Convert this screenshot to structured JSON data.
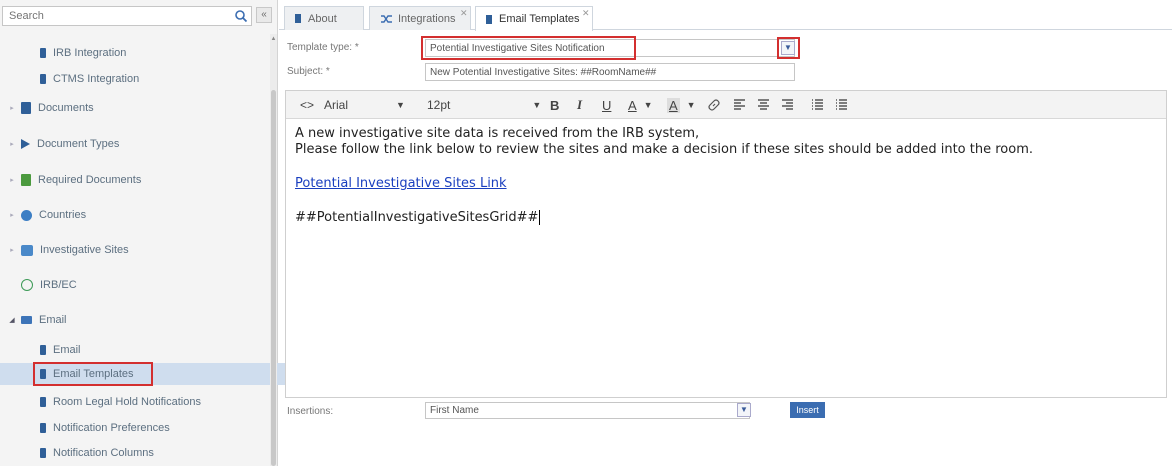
{
  "sidebar": {
    "search_placeholder": "Search",
    "collapse_glyph": "«",
    "items": [
      {
        "label": "IRB Integration",
        "icon": "document-icon"
      },
      {
        "label": "CTMS Integration",
        "icon": "document-icon"
      },
      {
        "label": "Documents",
        "icon": "document-icon"
      },
      {
        "label": "Document Types",
        "icon": "tag-icon"
      },
      {
        "label": "Required Documents",
        "icon": "required-document-icon"
      },
      {
        "label": "Countries",
        "icon": "globe-icon"
      },
      {
        "label": "Investigative Sites",
        "icon": "sites-icon"
      },
      {
        "label": "IRB/EC",
        "icon": "check-circle-icon"
      },
      {
        "label": "Email",
        "icon": "mail-icon"
      },
      {
        "label": "Email",
        "icon": "document-icon"
      },
      {
        "label": "Email Templates",
        "icon": "document-icon"
      },
      {
        "label": "Room Legal Hold Notifications",
        "icon": "document-icon"
      },
      {
        "label": "Notification Preferences",
        "icon": "document-icon"
      },
      {
        "label": "Notification Columns",
        "icon": "document-icon"
      }
    ]
  },
  "tabs": [
    {
      "label": "About",
      "icon": "document-icon"
    },
    {
      "label": "Integrations",
      "icon": "shuffle-icon"
    },
    {
      "label": "Email Templates",
      "icon": "document-icon"
    }
  ],
  "form": {
    "template_type_label": "Template type: *",
    "template_type_value": "Potential Investigative Sites Notification",
    "subject_label": "Subject: *",
    "subject_value": "New Potential Investigative Sites: ##RoomName##"
  },
  "toolbar": {
    "source": "<>",
    "font": "Arial",
    "size": "12pt",
    "bold": "B",
    "italic": "I",
    "underline": "U",
    "font_color": "A",
    "highlight": "A",
    "link": "🔗"
  },
  "content": {
    "line1": "A new investigative site data is received from the IRB system,",
    "line2": "Please follow the link below to review the sites and make a decision if these sites should be added into the room.",
    "link_text": "Potential Investigative Sites Link",
    "grid_token": "##PotentialInvestigativeSitesGrid##"
  },
  "insertions": {
    "label": "Insertions:",
    "value": "First Name",
    "insert_label": "Insert"
  },
  "colors": {
    "accent": "#2f5f98",
    "highlight_red": "#d32f2f",
    "selected_bg": "#cfddee"
  }
}
